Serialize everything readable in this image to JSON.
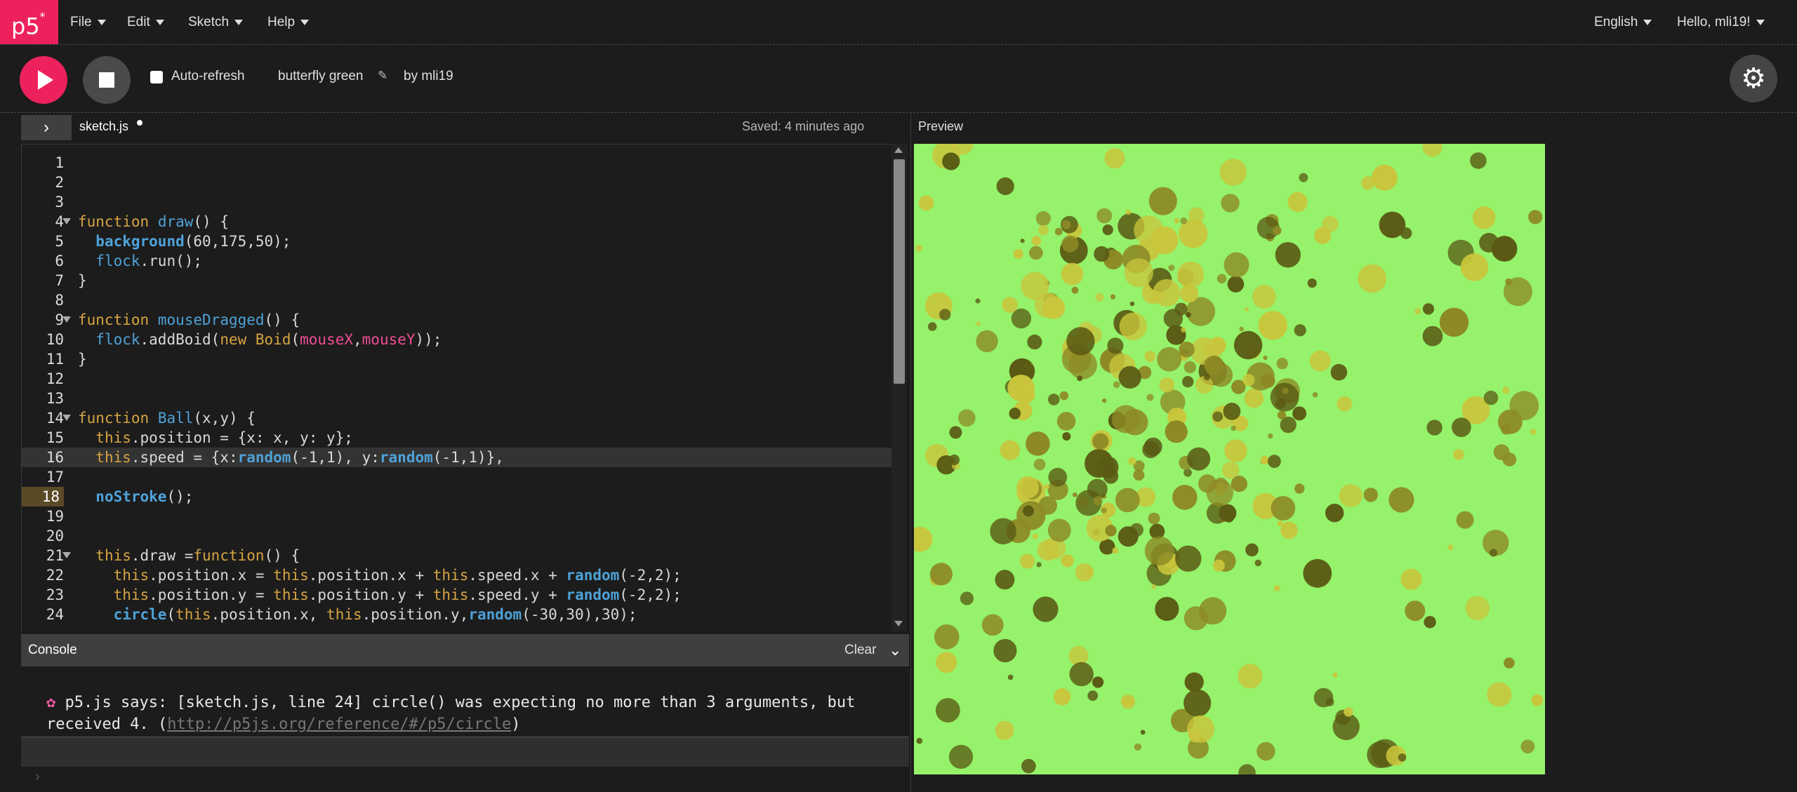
{
  "nav": {
    "logo": "p5",
    "logo_sup": "*",
    "menus": [
      "File",
      "Edit",
      "Sketch",
      "Help"
    ],
    "language": "English",
    "greeting": "Hello, mli19!"
  },
  "toolbar": {
    "play_icon": "play-icon",
    "stop_icon": "stop-icon",
    "auto_refresh_label": "Auto-refresh",
    "auto_refresh_checked": false,
    "project_name": "butterfly green",
    "by_user": "by mli19",
    "settings_icon": "gear-icon"
  },
  "editor": {
    "file_tab": "sketch.js",
    "saved_status": "Saved: 4 minutes ago",
    "preview_label": "Preview",
    "active_line": 16,
    "highlighted_gutter_line": 18,
    "lines": [
      "",
      "",
      "",
      "function draw() {",
      "  background(60,175,50);",
      "  flock.run();",
      "}",
      "",
      "function mouseDragged() {",
      "  flock.addBoid(new Boid(mouseX,mouseY));",
      "}",
      "",
      "",
      "function Ball(x,y) {",
      "  this.position = {x: x, y: y};",
      "  this.speed = {x:random(-1,1), y:random(-1,1)},",
      "",
      "  noStroke();",
      "",
      "",
      "  this.draw =function() {",
      "    this.position.x = this.position.x + this.speed.x + random(-2,2);",
      "    this.position.y = this.position.y + this.speed.y + random(-2,2);",
      "    circle(this.position.x, this.position.y,random(-30,30),30);"
    ]
  },
  "console": {
    "title": "Console",
    "clear_label": "Clear",
    "message": "p5.js says: [sketch.js, line 24] circle() was expecting no more than 3 arguments, but received 4. (",
    "link": "http://p5js.org/reference/#/p5/circle",
    "message_end": ")"
  },
  "colors": {
    "accent": "#ed225d",
    "canvas_bg": "#95f26a",
    "dot_dark": "#5a5a14",
    "dot_mid": "#8d8a26",
    "dot_light": "#c9c53c"
  }
}
